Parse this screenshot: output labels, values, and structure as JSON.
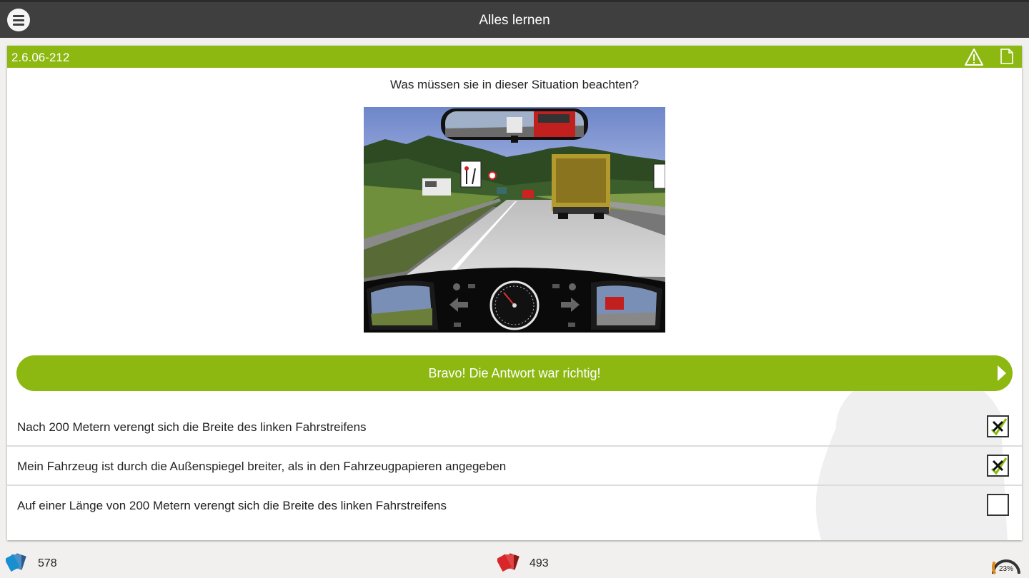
{
  "app": {
    "title": "Alles lernen"
  },
  "question": {
    "id": "2.6.06-212",
    "text": "Was müssen sie in dieser Situation beachten?",
    "image_icon": "traffic-scene-image"
  },
  "feedback": {
    "text": "Bravo! Die Antwort war richtig!",
    "color": "#8cb811"
  },
  "answers": [
    {
      "text": "Nach 200 Metern verengt sich die Breite des linken Fahrstreifens",
      "checked": true
    },
    {
      "text": "Mein Fahrzeug ist durch die Außenspiegel breiter, als in den Fahrzeugpapieren angegeben",
      "checked": true
    },
    {
      "text": "Auf einer Länge von 200 Metern verengt sich die Breite des linken Fahrstreifens",
      "checked": false
    }
  ],
  "footer": {
    "blue_cards_count": "578",
    "red_cards_count": "493",
    "progress_label": "23%",
    "progress_value": 0.23
  },
  "colors": {
    "accent_green": "#8cb811",
    "topbar": "#3f3f3f",
    "blue_cards": "#1a8fd0",
    "red_cards": "#d9262a",
    "progress": "#e08a1e"
  },
  "icons": {
    "menu": "hamburger-menu-icon",
    "warning": "warning-triangle-icon",
    "document": "document-icon",
    "next": "chevron-right-icon",
    "blue_cards": "blue-cards-icon",
    "red_cards": "red-cards-icon",
    "progress": "progress-gauge-icon"
  }
}
